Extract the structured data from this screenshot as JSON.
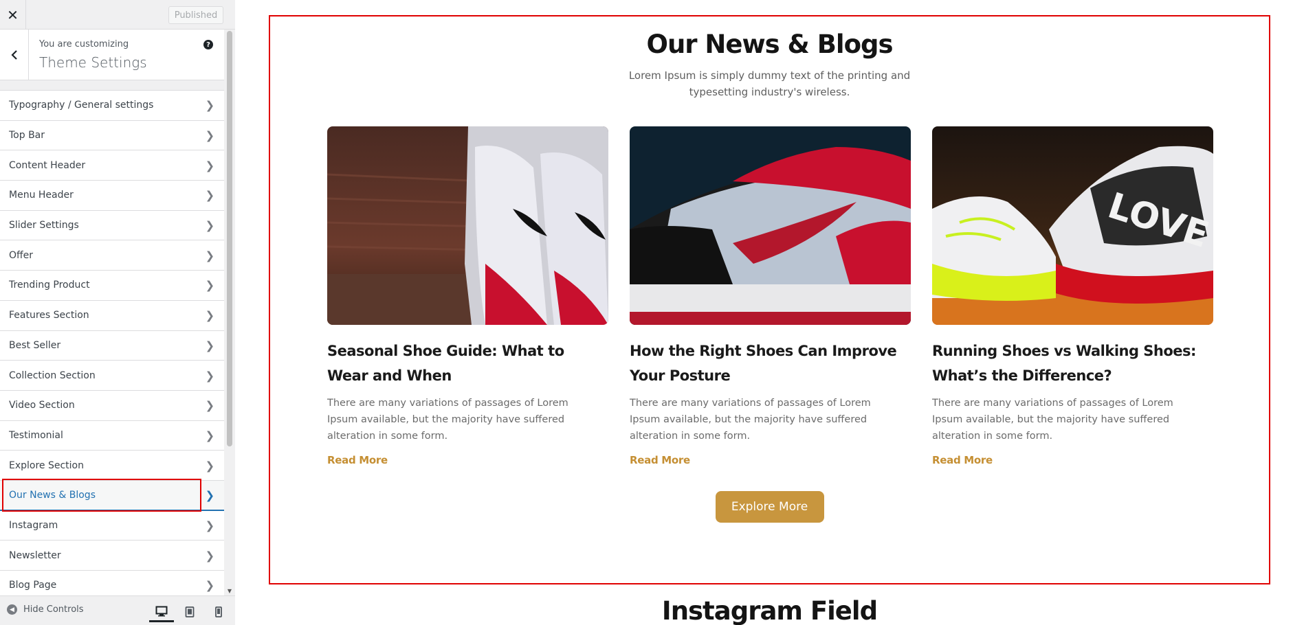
{
  "header": {
    "close_label": "✕",
    "published_label": "Published"
  },
  "info": {
    "customizing_label": "You are customizing",
    "theme_title": "Theme Settings",
    "help_label": "?"
  },
  "sections": [
    {
      "label": "Typography / General settings"
    },
    {
      "label": "Top Bar"
    },
    {
      "label": "Content Header"
    },
    {
      "label": "Menu Header"
    },
    {
      "label": "Slider Settings"
    },
    {
      "label": "Offer"
    },
    {
      "label": "Trending Product"
    },
    {
      "label": "Features Section"
    },
    {
      "label": "Best Seller"
    },
    {
      "label": "Collection Section"
    },
    {
      "label": "Video Section"
    },
    {
      "label": "Testimonial"
    },
    {
      "label": "Explore Section"
    },
    {
      "label": "Our News & Blogs"
    },
    {
      "label": "Instagram"
    },
    {
      "label": "Newsletter"
    },
    {
      "label": "Blog Page"
    }
  ],
  "active_section": "Our News & Blogs",
  "footer": {
    "hide_controls_label": "Hide Controls"
  },
  "preview": {
    "blog_title": "Our News & Blogs",
    "blog_subtitle": "Lorem Ipsum is simply dummy text of the printing and typesetting industry's wireless.",
    "cards": [
      {
        "title": "Seasonal Shoe Guide: What to Wear and When",
        "text": "There are many variations of passages of Lorem Ipsum available, but the majority have suffered alteration in some form.",
        "link": "Read More"
      },
      {
        "title": "How the Right Shoes Can Improve Your Posture",
        "text": "There are many variations of passages of Lorem Ipsum available, but the majority have suffered alteration in some form.",
        "link": "Read More"
      },
      {
        "title": "Running Shoes vs Walking Shoes: What’s the Difference?",
        "text": "There are many variations of passages of Lorem Ipsum available, but the majority have suffered alteration in some form.",
        "link": "Read More"
      }
    ],
    "explore_label": "Explore More",
    "next_section_title": "Instagram Field"
  },
  "colors": {
    "accent": "#c8963e",
    "link": "#c58f33",
    "active_blue": "#2271b1",
    "highlight_red": "#e00000"
  }
}
